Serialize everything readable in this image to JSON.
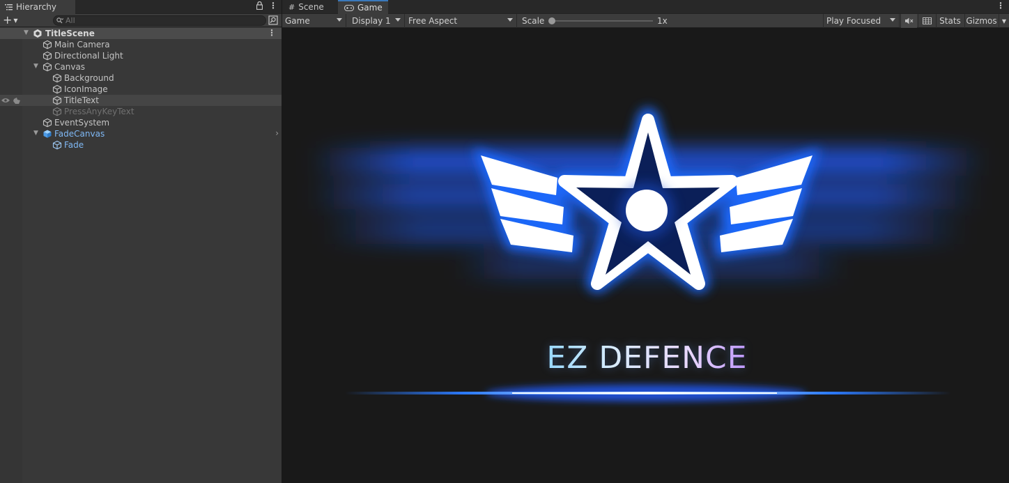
{
  "hierarchy": {
    "tab_label": "Hierarchy",
    "search_placeholder": "All",
    "scene_name": "TitleScene",
    "items": [
      {
        "label": "Main Camera"
      },
      {
        "label": "Directional Light"
      },
      {
        "label": "Canvas"
      },
      {
        "label": "Background"
      },
      {
        "label": "IconImage"
      },
      {
        "label": "TitleText"
      },
      {
        "label": "PressAnyKeyText"
      },
      {
        "label": "EventSystem"
      },
      {
        "label": "FadeCanvas"
      },
      {
        "label": "Fade"
      }
    ]
  },
  "game_view": {
    "tabs": [
      {
        "label": "Scene"
      },
      {
        "label": "Game"
      }
    ],
    "toolbar": {
      "mode": "Game",
      "display": "Display 1",
      "aspect": "Free Aspect",
      "scale_label": "Scale",
      "scale_value": "1x",
      "play_mode": "Play Focused",
      "stats": "Stats",
      "gizmos": "Gizmos"
    },
    "content": {
      "title": "EZ DEFENCE"
    }
  },
  "colors": {
    "accent": "#3a79bb",
    "prefab_text": "#7fb8f5",
    "logo_blue": "#1e6bff"
  }
}
